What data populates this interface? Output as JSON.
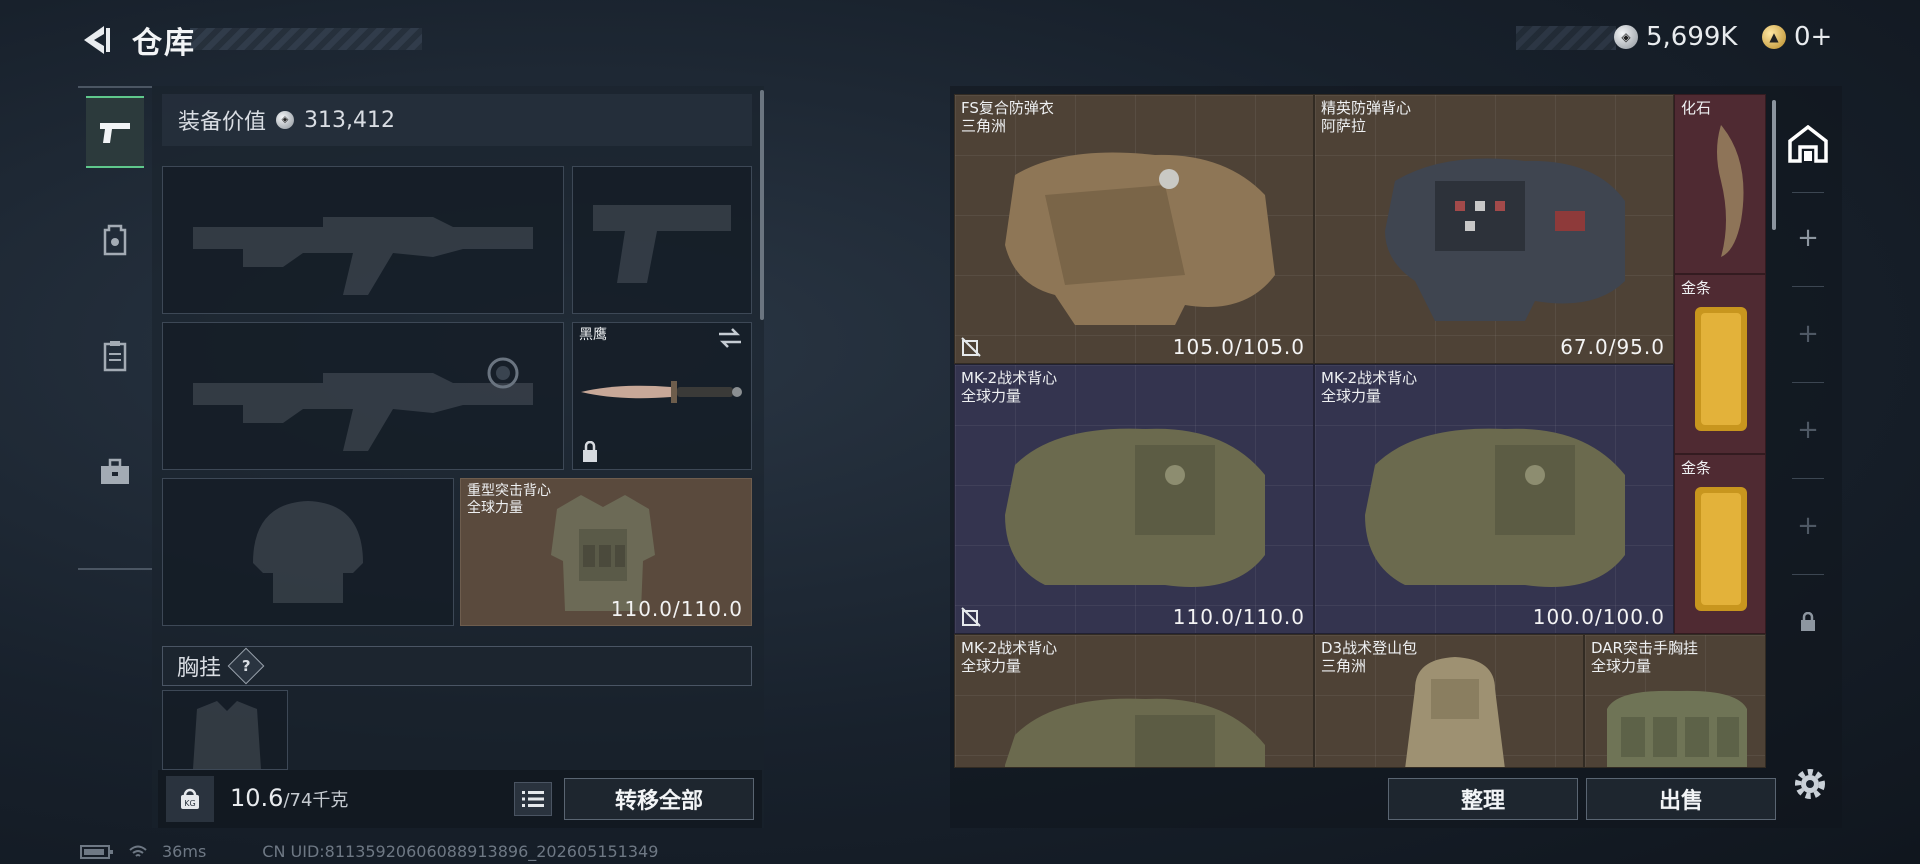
{
  "header": {
    "title": "仓库",
    "currency_silver": "5,699K",
    "currency_gold": "0+"
  },
  "loadout": {
    "equip_value_label": "装备价值",
    "equip_value": "313,412",
    "melee": {
      "name": "黑鹰"
    },
    "armor": {
      "name": "重型突击背心",
      "brand": "全球力量",
      "durability": "110.0/110.0"
    },
    "chest_rig_label": "胸挂",
    "chest_rig_help": "?",
    "weight_current": "10.6",
    "weight_max": "/74千克",
    "transfer_all": "转移全部"
  },
  "stash": {
    "items": [
      {
        "name": "FS复合防弹衣",
        "brand": "三角洲",
        "durability": "105.0/105.0",
        "bg": "brown"
      },
      {
        "name": "精英防弹背心",
        "brand": "阿萨拉",
        "durability": "67.0/95.0",
        "bg": "brown"
      },
      {
        "name": "化石",
        "bg": "red"
      },
      {
        "name": "金条",
        "bg": "red"
      },
      {
        "name": "MK-2战术背心",
        "brand": "全球力量",
        "durability": "110.0/110.0",
        "bg": "blue"
      },
      {
        "name": "MK-2战术背心",
        "brand": "全球力量",
        "durability": "100.0/100.0",
        "bg": "blue"
      },
      {
        "name": "金条",
        "bg": "red"
      },
      {
        "name": "MK-2战术背心",
        "brand": "全球力量",
        "bg": "brown"
      },
      {
        "name": "D3战术登山包",
        "brand": "三角洲",
        "bg": "brown"
      },
      {
        "name": "DAR突击手胸挂",
        "brand": "全球力量",
        "bg": "brown"
      }
    ],
    "sort": "整理",
    "sell": "出售"
  },
  "status": {
    "ping": "36ms",
    "uid": "CN UID:81135920606088913896_202605151349"
  },
  "colors": {
    "accent_green": "#5fc88c",
    "cell_brown": "#4e4236",
    "cell_blue": "#34344f",
    "cell_red": "#4f2a32"
  }
}
